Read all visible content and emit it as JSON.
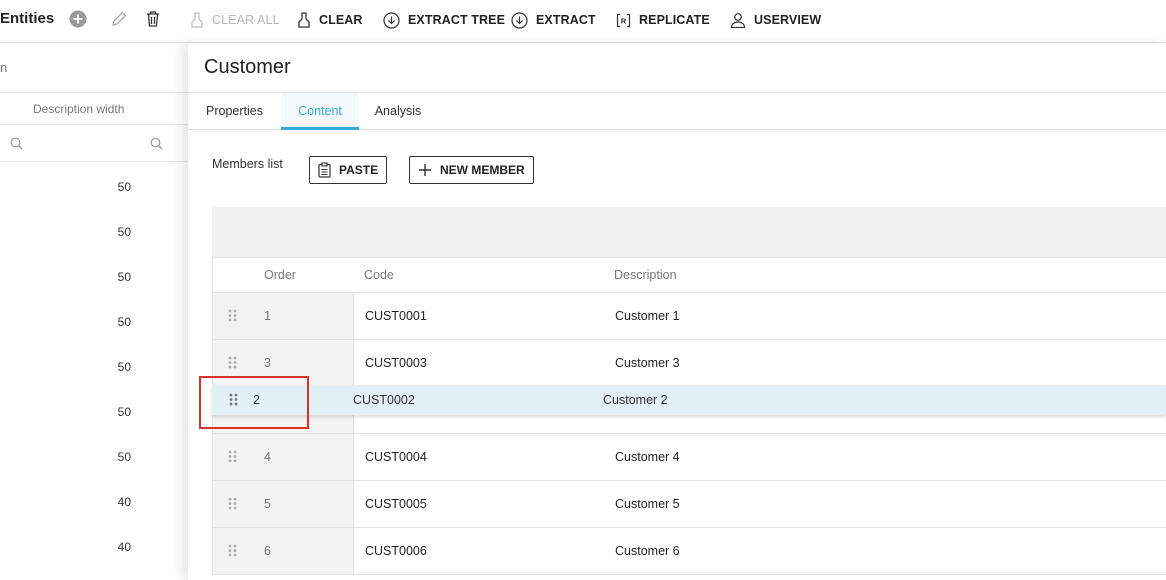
{
  "toolbar": {
    "title": "Entities",
    "clear_all": "CLEAR ALL",
    "clear": "CLEAR",
    "extract_tree": "EXTRACT TREE",
    "extract": "EXTRACT",
    "replicate": "REPLICATE",
    "userview": "USERVIEW"
  },
  "left_panel": {
    "header_fragment": "n",
    "column_header": "Description width",
    "values": [
      "50",
      "50",
      "50",
      "50",
      "50",
      "50",
      "50",
      "40",
      "40"
    ]
  },
  "detail": {
    "title": "Customer",
    "tabs": [
      {
        "label": "Properties",
        "active": false
      },
      {
        "label": "Content",
        "active": true
      },
      {
        "label": "Analysis",
        "active": false
      }
    ],
    "members_label": "Members list",
    "paste_label": "PASTE",
    "new_member_label": "NEW MEMBER",
    "grid": {
      "columns": [
        "Order",
        "Code",
        "Description"
      ],
      "rows": [
        {
          "order": "1",
          "code": "CUST0001",
          "description": "Customer 1"
        },
        {
          "order": "3",
          "code": "CUST0003",
          "description": "Customer 3"
        },
        {
          "order": "",
          "code": "",
          "description": ""
        },
        {
          "order": "4",
          "code": "CUST0004",
          "description": "Customer 4"
        },
        {
          "order": "5",
          "code": "CUST0005",
          "description": "Customer 5"
        },
        {
          "order": "6",
          "code": "CUST0006",
          "description": "Customer 6"
        }
      ],
      "dragged_row": {
        "order": "2",
        "code": "CUST0002",
        "description": "Customer 2"
      }
    }
  },
  "colors": {
    "accent": "#3aa8d8",
    "highlight": "#d9302c",
    "drag_row": "#e1f0f4"
  }
}
